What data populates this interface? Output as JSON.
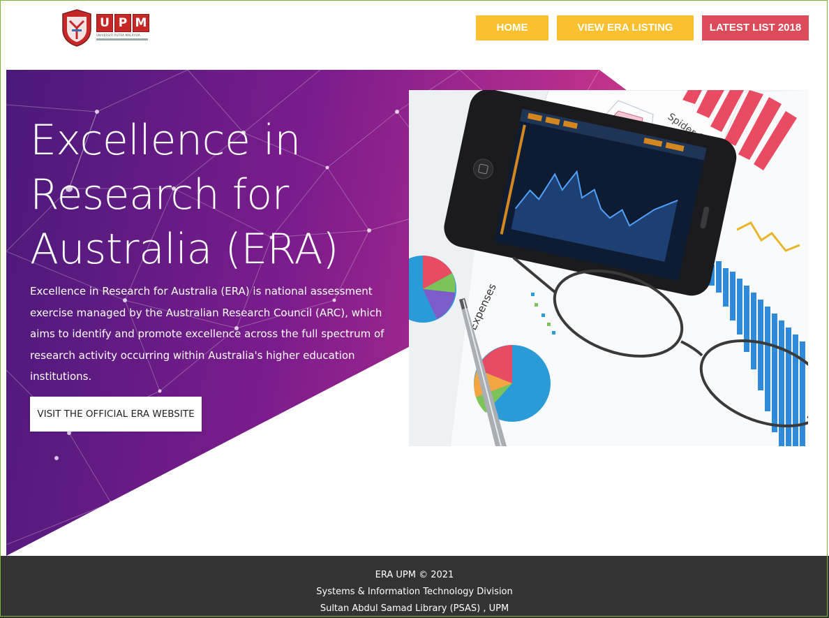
{
  "header": {
    "logo": {
      "wordmark": [
        "U",
        "P",
        "M"
      ],
      "tagline": "UNIVERSITI PUTRA MALAYSIA"
    },
    "nav": [
      {
        "label": "HOME",
        "color": "#fbc02d"
      },
      {
        "label": "VIEW ERA LISTING",
        "color": "#fbc02d"
      },
      {
        "label": "LATEST LIST 2018",
        "color": "#dc4b59"
      }
    ]
  },
  "hero": {
    "title": "Excellence in Research for Australia (ERA)",
    "description": "Excellence in Research for Australia (ERA) is national assessment exercise managed by the Australian Research Council (ARC), which aims to identify and promote excellence across the full spectrum of research activity occurring within Australia's higher education institutions.",
    "button_label": "VISIT THE OFFICIAL ERA WEBSITE",
    "photo": {
      "icons": [
        "smartphone-icon",
        "eyeglasses-icon",
        "pen-icon",
        "pie-chart-icon",
        "bar-chart-icon"
      ],
      "labels": {
        "spider_chart": "Spider Chart",
        "expenses": "Expenses"
      }
    }
  },
  "footer": {
    "line1": "ERA UPM © 2021",
    "line2": "Systems & Information Technology Division",
    "line3": "Sultan Abdul Samad Library  (PSAS) , UPM"
  },
  "colors": {
    "accent_yellow": "#fbc02d",
    "accent_red": "#dc4b59",
    "footer_bg": "#333333",
    "hero_gradient_start": "#4a1a7a",
    "hero_gradient_end": "#f04a76"
  }
}
